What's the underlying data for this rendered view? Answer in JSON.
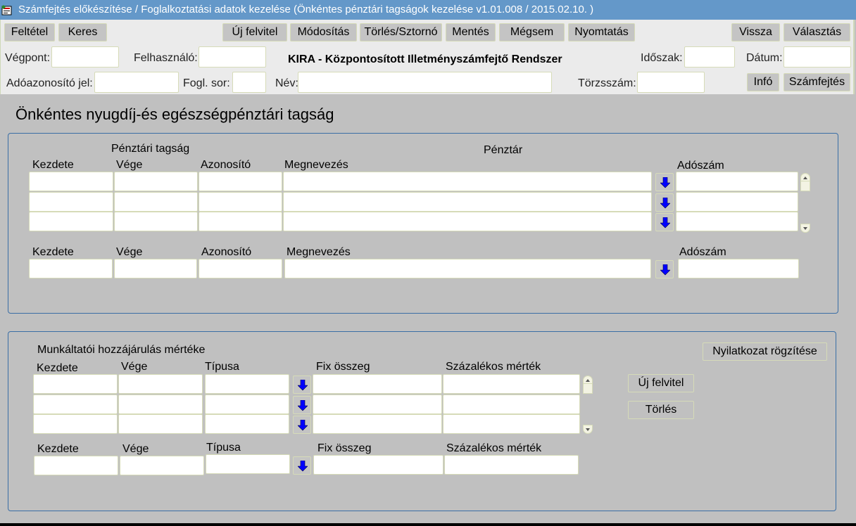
{
  "window": {
    "title": "Számfejtés előkészítése / Foglalkoztatási adatok kezelése (Önkéntes pénztári tagságok kezelése v1.01.008 / 2015.02.10. )",
    "icon": "app-form-icon"
  },
  "toolbar": {
    "feltetel": "Feltétel",
    "keres": "Keres",
    "uj_felvitel": "Új felvitel",
    "modositas": "Módosítás",
    "torles_sztorno": "Törlés/Sztornó",
    "mentes": "Mentés",
    "megsem": "Mégsem",
    "nyomtatas": "Nyomtatás",
    "vissza": "Vissza",
    "valasztas": "Választás",
    "info": "Infó",
    "szamfejtes": "Számfejtés"
  },
  "header": {
    "system_title": "KIRA - Központosított Illetményszámfejtő Rendszer",
    "fields": {
      "vegpont": {
        "label": "Végpont:",
        "value": ""
      },
      "felhasznalo": {
        "label": "Felhasználó:",
        "value": ""
      },
      "idoszak": {
        "label": "Időszak:",
        "value": ""
      },
      "datum": {
        "label": "Dátum:",
        "value": ""
      },
      "adoazonosito": {
        "label": "Adóazonosító jel:",
        "value": ""
      },
      "fogl_sor": {
        "label": "Fogl. sor:",
        "value": ""
      },
      "nev": {
        "label": "Név:",
        "value": ""
      },
      "torzsszam": {
        "label": "Törzsszám:",
        "value": ""
      }
    }
  },
  "page_title": "Önkéntes nyugdíj-és egészségpénztári tagság",
  "membership": {
    "group_label_tagsag": "Pénztári tagság",
    "group_label_penztar": "Pénztár",
    "columns": [
      "Kezdete",
      "Vége",
      "Azonosító",
      "Megnevezés",
      "Adószám"
    ],
    "rows": [
      {
        "kezdete": "",
        "vege": "",
        "azonosito": "",
        "megnevezes": "",
        "adoszam": ""
      },
      {
        "kezdete": "",
        "vege": "",
        "azonosito": "",
        "megnevezes": "",
        "adoszam": ""
      },
      {
        "kezdete": "",
        "vege": "",
        "azonosito": "",
        "megnevezes": "",
        "adoszam": ""
      }
    ],
    "detail_columns": [
      "Kezdete",
      "Vége",
      "Azonosító",
      "Megnevezés",
      "Adószám"
    ],
    "detail": {
      "kezdete": "",
      "vege": "",
      "azonosito": "",
      "megnevezes": "",
      "adoszam": ""
    }
  },
  "contribution": {
    "title": "Munkáltatói hozzájárulás mértéke",
    "columns": [
      "Kezdete",
      "Vége",
      "Típusa",
      "Fix összeg",
      "Százalékos mérték"
    ],
    "rows": [
      {
        "kezdete": "",
        "vege": "",
        "tipusa": "",
        "fix": "",
        "szazalek": ""
      },
      {
        "kezdete": "",
        "vege": "",
        "tipusa": "",
        "fix": "",
        "szazalek": ""
      },
      {
        "kezdete": "",
        "vege": "",
        "tipusa": "",
        "fix": "",
        "szazalek": ""
      }
    ],
    "detail_columns": [
      "Kezdete",
      "Vége",
      "Típusa",
      "Fix összeg",
      "Százalékos mérték"
    ],
    "detail": {
      "kezdete": "",
      "vege": "",
      "tipusa": "",
      "fix": "",
      "szazalek": ""
    },
    "buttons": {
      "nyilatkozat": "Nyilatkozat rögzítése",
      "uj_felvitel": "Új felvitel",
      "torles": "Törlés"
    }
  },
  "colors": {
    "titlebar": "#6498c9",
    "panel_border": "#3a6ea5",
    "lov_arrow": "#0000ff"
  }
}
